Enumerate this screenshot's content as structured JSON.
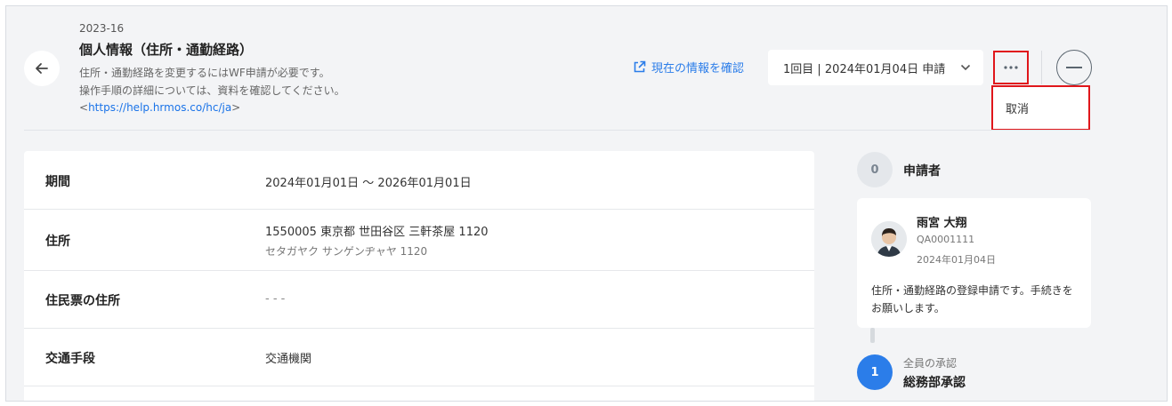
{
  "header": {
    "doc_number": "2023-16",
    "title": "個人情報（住所・通勤経路）",
    "description_line1": "住所・通勤経路を変更するにはWF申請が必要です。",
    "description_line2": "操作手順の詳細については、資料を確認してください。",
    "help_link_prefix": "<",
    "help_link": "https://help.hrmos.co/hc/ja",
    "help_link_suffix": ">"
  },
  "toolbar": {
    "view_current_info": "現在の情報を確認",
    "submission_select": "1回目 | 2024年01月04日 申請",
    "more_icon": "more-horizontal-icon",
    "menu": [
      {
        "label": "取消"
      }
    ]
  },
  "details": {
    "rows": [
      {
        "label": "期間",
        "value": "2024年01月01日 〜 2026年01月01日"
      },
      {
        "label": "住所",
        "value": "1550005 東京都 世田谷区 三軒茶屋 1120",
        "sub": "セタガヤク サンゲンヂャヤ 1120"
      },
      {
        "label": "住民票の住所",
        "value": "- - -"
      },
      {
        "label": "交通手段",
        "value": "交通機関"
      }
    ]
  },
  "approval_flow": {
    "steps": [
      {
        "number": "0",
        "label": "申請者",
        "applicant": {
          "name": "雨宮 大翔",
          "id": "QA0001111",
          "date": "2024年01月04日",
          "comment": "住所・通勤経路の登録申請です。手続きをお願いします。"
        }
      },
      {
        "number": "1",
        "sublabel": "全員の承認",
        "label": "総務部承認"
      }
    ]
  },
  "colors": {
    "accent": "#2b7de9",
    "highlight_border": "#e0161b",
    "background": "#f3f4f6"
  }
}
